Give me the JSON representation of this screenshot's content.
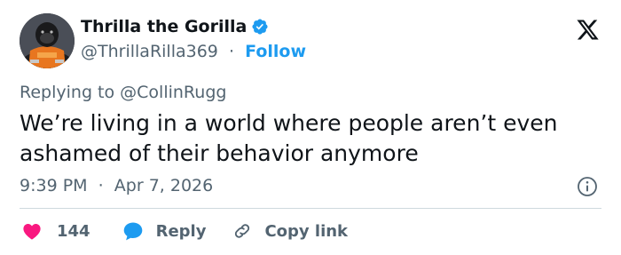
{
  "author": {
    "display_name": "Thrilla the Gorilla",
    "handle": "@ThrillaRilla369",
    "separator": "·",
    "follow_label": "Follow",
    "verified": true,
    "avatar_icon": "gorilla-avatar"
  },
  "brand_icon": "x-logo-icon",
  "reply": {
    "prefix": "Replying to ",
    "mention": "@CollinRugg"
  },
  "tweet": {
    "text": "We’re living in a world where people aren’t even ashamed of their behavior anymore"
  },
  "meta": {
    "time": "9:39 PM",
    "separator": "·",
    "date": "Apr 7, 2026"
  },
  "actions": {
    "like_count": "144",
    "reply_label": "Reply",
    "copy_label": "Copy link"
  },
  "colors": {
    "accent": "#1d9bf0",
    "like": "#f91880",
    "text": "#0f1419",
    "muted": "#536471",
    "divider": "#cfd9de"
  }
}
